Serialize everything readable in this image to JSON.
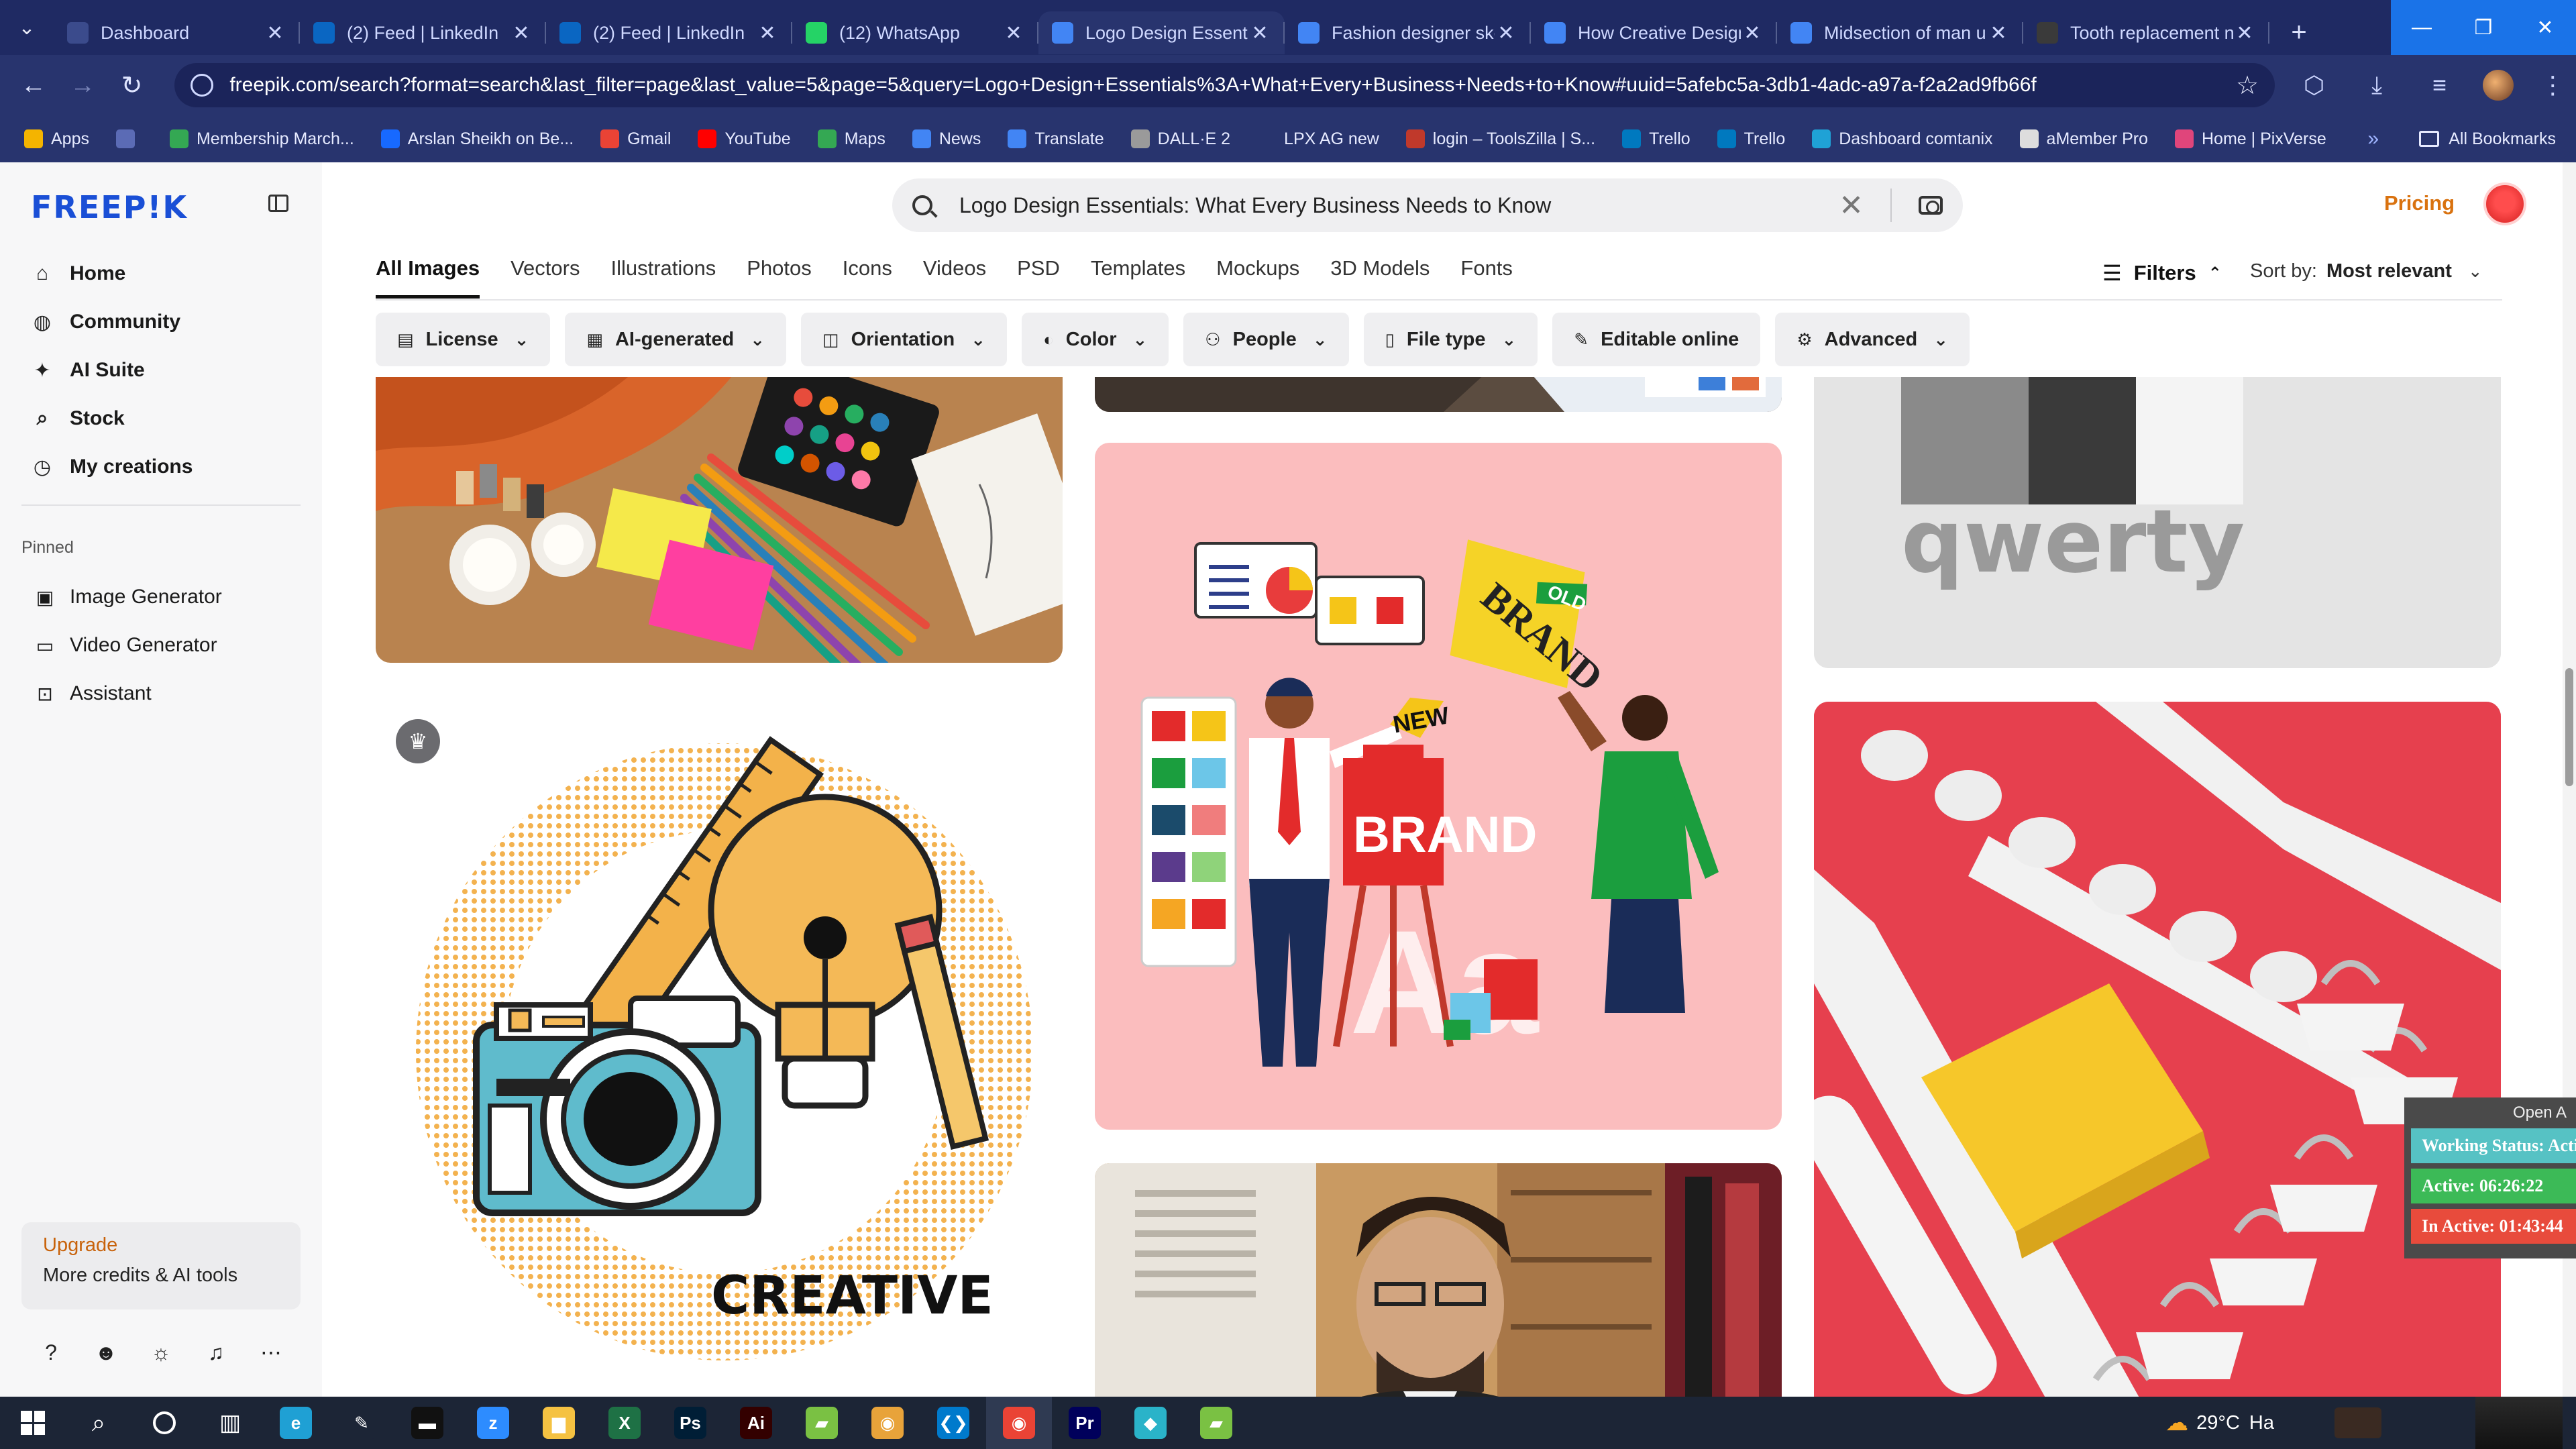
{
  "browser": {
    "tabs": [
      {
        "title": "Dashboard",
        "favicon_color": "#3b4b8c",
        "active": false
      },
      {
        "title": "(2) Feed | LinkedIn",
        "favicon_color": "#0a66c2",
        "active": false
      },
      {
        "title": "(2) Feed | LinkedIn",
        "favicon_color": "#0a66c2",
        "active": false
      },
      {
        "title": "(12) WhatsApp",
        "favicon_color": "#25d366",
        "active": false
      },
      {
        "title": "Logo Design Essenti",
        "favicon_color": "#4285f4",
        "active": true
      },
      {
        "title": "Fashion designer ske",
        "favicon_color": "#4285f4",
        "active": false
      },
      {
        "title": "How Creative Design",
        "favicon_color": "#4285f4",
        "active": false
      },
      {
        "title": "Midsection of man u",
        "favicon_color": "#4285f4",
        "active": false
      },
      {
        "title": "Tooth replacement n",
        "favicon_color": "#3a3a3a",
        "active": false
      }
    ],
    "url": "freepik.com/search?format=search&last_filter=page&last_value=5&page=5&query=Logo+Design+Essentials%3A+What+Every+Business+Needs+to+Know#uuid=5afebc5a-3db1-4adc-a97a-f2a2ad9fb66f",
    "bookmarks": [
      {
        "label": "Apps",
        "color": "#f4b400"
      },
      {
        "label": "",
        "color": "#5b6bb5"
      },
      {
        "label": "Membership March...",
        "color": "#34a853"
      },
      {
        "label": "Arslan Sheikh on Be...",
        "color": "#1769ff"
      },
      {
        "label": "Gmail",
        "color": "#ea4335"
      },
      {
        "label": "YouTube",
        "color": "#ff0000"
      },
      {
        "label": "Maps",
        "color": "#34a853"
      },
      {
        "label": "News",
        "color": "#4285f4"
      },
      {
        "label": "Translate",
        "color": "#4285f4"
      },
      {
        "label": "DALL·E 2",
        "color": "#9a9a9a"
      },
      {
        "label": "LPX AG new",
        "color": "#28346e"
      },
      {
        "label": "login – ToolsZilla | S...",
        "color": "#c0392b"
      },
      {
        "label": "Trello",
        "color": "#0079bf"
      },
      {
        "label": "Trello",
        "color": "#0079bf"
      },
      {
        "label": "Dashboard comtanix",
        "color": "#1fa2d6"
      },
      {
        "label": "aMember Pro",
        "color": "#dddddd"
      },
      {
        "label": "Home | PixVerse",
        "color": "#e0457b"
      }
    ],
    "all_bookmarks": "All Bookmarks"
  },
  "sidebar": {
    "logo": "FREEP!K",
    "nav": [
      {
        "label": "Home",
        "icon": "home-icon",
        "glyph": "⌂"
      },
      {
        "label": "Community",
        "icon": "globe-icon",
        "glyph": "◍"
      },
      {
        "label": "AI Suite",
        "icon": "sparkle-icon",
        "glyph": "✦"
      },
      {
        "label": "Stock",
        "icon": "search-icon",
        "glyph": "⌕"
      },
      {
        "label": "My creations",
        "icon": "clock-icon",
        "glyph": "◷"
      }
    ],
    "pinned_heading": "Pinned",
    "pinned": [
      {
        "label": "Image Generator",
        "icon": "image-icon",
        "glyph": "▣"
      },
      {
        "label": "Video Generator",
        "icon": "video-icon",
        "glyph": "▭"
      },
      {
        "label": "Assistant",
        "icon": "chat-icon",
        "glyph": "⊡"
      }
    ],
    "upgrade_title": "Upgrade",
    "upgrade_subtitle": "More credits & AI tools"
  },
  "header": {
    "search_query": "Logo Design Essentials: What Every Business Needs to Know",
    "pricing": "Pricing",
    "type_tabs": [
      "All Images",
      "Vectors",
      "Illustrations",
      "Photos",
      "Icons",
      "Videos",
      "PSD",
      "Templates",
      "Mockups",
      "3D Models",
      "Fonts"
    ],
    "filters_label": "Filters",
    "sort_label": "Sort by:",
    "sort_value": "Most relevant",
    "chips": [
      {
        "label": "License",
        "icon": "license-icon",
        "glyph": "▤",
        "dropdown": true
      },
      {
        "label": "AI-generated",
        "icon": "ai-icon",
        "glyph": "▦",
        "dropdown": true
      },
      {
        "label": "Orientation",
        "icon": "orientation-icon",
        "glyph": "◫",
        "dropdown": true
      },
      {
        "label": "Color",
        "icon": "palette-icon",
        "glyph": "◐",
        "dropdown": true
      },
      {
        "label": "People",
        "icon": "people-icon",
        "glyph": "⚇",
        "dropdown": true
      },
      {
        "label": "File type",
        "icon": "file-icon",
        "glyph": "▯",
        "dropdown": true
      },
      {
        "label": "Editable online",
        "icon": "brush-icon",
        "glyph": "✎",
        "dropdown": false
      },
      {
        "label": "Advanced",
        "icon": "gear-icon",
        "glyph": "⚙",
        "dropdown": true
      }
    ]
  },
  "results": {
    "creative_text": "CREATIVE",
    "brand_old": "BRAND",
    "old_tag": "OLD",
    "new_tag": "NEW",
    "brand_new": "BRAND",
    "aa_text": "Aa",
    "qwerty_text": "qwerty"
  },
  "status_widget": {
    "header": "Open A",
    "working_status": "Working Status: Active",
    "active_time": "Active: 06:26:22",
    "inactive_time": "In Active: 01:43:44"
  },
  "taskbar": {
    "temperature": "29°C",
    "weather_text": "Ha",
    "apps": [
      {
        "name": "edge-icon",
        "color": "#1fa0d4",
        "glyph": "e"
      },
      {
        "name": "pen-icon",
        "color": "#1c2536",
        "glyph": "✎"
      },
      {
        "name": "terminal-icon",
        "color": "#111111",
        "glyph": "▬"
      },
      {
        "name": "zoom-icon",
        "color": "#2d8cff",
        "glyph": "z"
      },
      {
        "name": "file-explorer-icon",
        "color": "#f5c242",
        "glyph": "▆"
      },
      {
        "name": "excel-icon",
        "color": "#1e7145",
        "glyph": "X"
      },
      {
        "name": "photoshop-icon",
        "color": "#001e36",
        "glyph": "Ps"
      },
      {
        "name": "illustrator-icon",
        "color": "#330000",
        "glyph": "Ai"
      },
      {
        "name": "sheets-icon",
        "color": "#7ac143",
        "glyph": "▰"
      },
      {
        "name": "chrome-icon",
        "color": "#e8a33a",
        "glyph": "◉"
      },
      {
        "name": "vscode-icon",
        "color": "#007acc",
        "glyph": "❮❯"
      },
      {
        "name": "chrome-profile-icon",
        "color": "#ea4335",
        "glyph": "◉"
      },
      {
        "name": "premiere-icon",
        "color": "#00005b",
        "glyph": "Pr"
      },
      {
        "name": "app-icon",
        "color": "#2ab3c9",
        "glyph": "◆"
      },
      {
        "name": "sheets-2-icon",
        "color": "#7ac143",
        "glyph": "▰"
      }
    ]
  }
}
